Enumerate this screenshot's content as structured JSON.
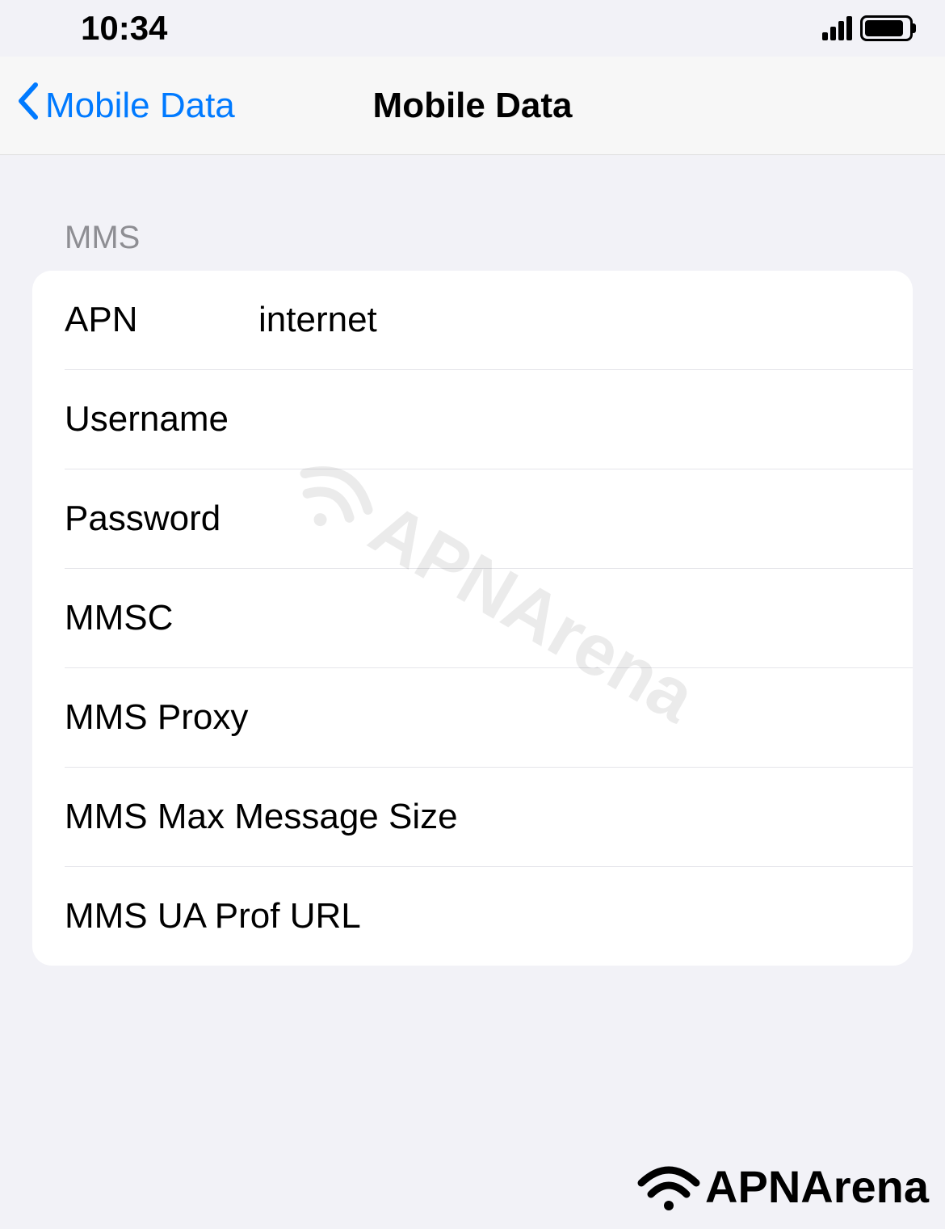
{
  "status_bar": {
    "time": "10:34"
  },
  "nav": {
    "back_label": "Mobile Data",
    "title": "Mobile Data"
  },
  "section": {
    "header": "MMS",
    "rows": [
      {
        "label": "APN",
        "value": "internet"
      },
      {
        "label": "Username",
        "value": ""
      },
      {
        "label": "Password",
        "value": ""
      },
      {
        "label": "MMSC",
        "value": ""
      },
      {
        "label": "MMS Proxy",
        "value": ""
      },
      {
        "label": "MMS Max Message Size",
        "value": ""
      },
      {
        "label": "MMS UA Prof URL",
        "value": ""
      }
    ]
  },
  "watermark": {
    "text": "APNArena"
  }
}
